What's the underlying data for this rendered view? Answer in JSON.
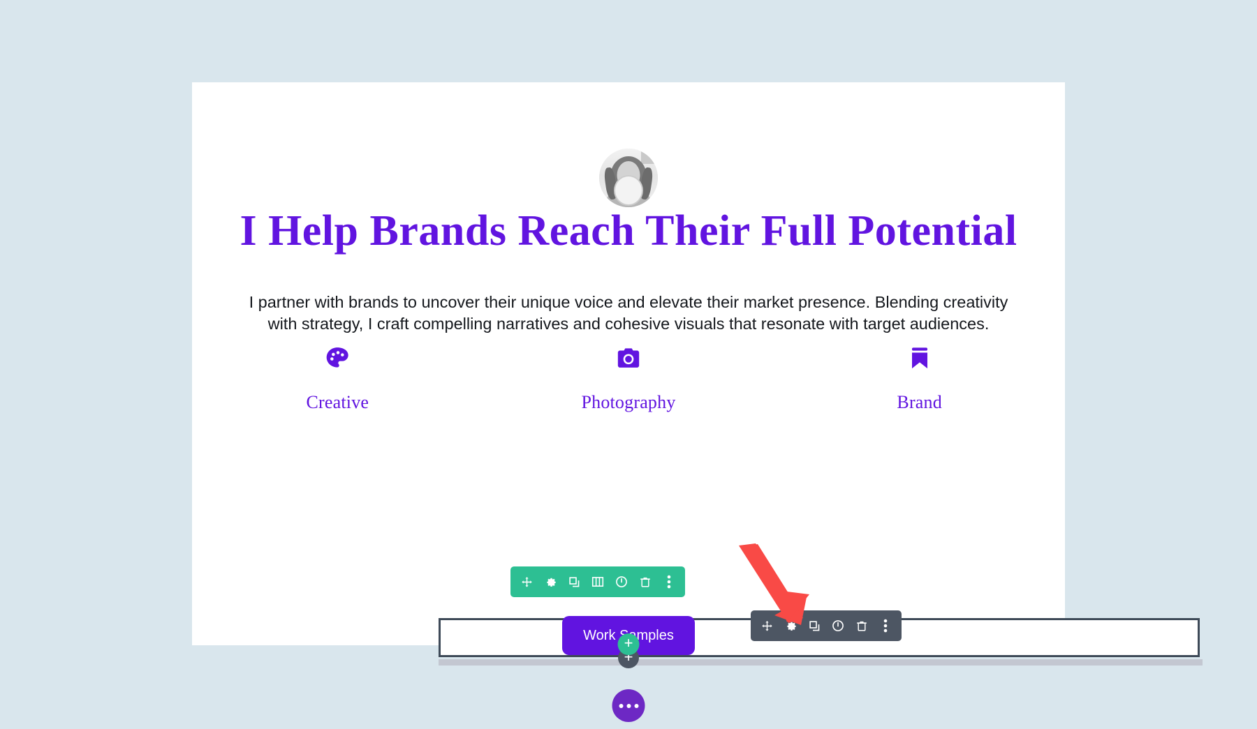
{
  "page": {
    "background_color": "#d9e6ed",
    "canvas_color": "#ffffff"
  },
  "hero": {
    "avatar_alt": "profile-photo",
    "headline": "I Help Brands Reach Their Full Potential",
    "headline_color": "#6114e0",
    "paragraph": "I partner with brands to uncover their unique voice and elevate their market presence. Blending creativity with strategy, I craft compelling narratives and cohesive visuals that resonate with target audiences."
  },
  "features": [
    {
      "icon": "palette-icon",
      "label": "Creative"
    },
    {
      "icon": "camera-icon",
      "label": "Photography"
    },
    {
      "icon": "bookmark-icon",
      "label": "Brand"
    }
  ],
  "cta": {
    "button_label": "Work Samples",
    "button_color": "#6114e0"
  },
  "builder": {
    "row_toolbar": {
      "color": "#2dbf93",
      "buttons": [
        {
          "icon": "move-icon",
          "tooltip": "Move"
        },
        {
          "icon": "gear-icon",
          "tooltip": "Settings"
        },
        {
          "icon": "duplicate-icon",
          "tooltip": "Duplicate"
        },
        {
          "icon": "columns-icon",
          "tooltip": "Column Structure"
        },
        {
          "icon": "power-icon",
          "tooltip": "Disable"
        },
        {
          "icon": "trash-icon",
          "tooltip": "Delete"
        },
        {
          "icon": "kebab-menu-icon",
          "tooltip": "More Options"
        }
      ]
    },
    "module_toolbar": {
      "color": "#4d5663",
      "buttons": [
        {
          "icon": "move-icon",
          "tooltip": "Move"
        },
        {
          "icon": "gear-icon",
          "tooltip": "Settings"
        },
        {
          "icon": "duplicate-icon",
          "tooltip": "Duplicate"
        },
        {
          "icon": "power-icon",
          "tooltip": "Disable"
        },
        {
          "icon": "trash-icon",
          "tooltip": "Delete"
        },
        {
          "icon": "kebab-menu-icon",
          "tooltip": "More Options"
        }
      ]
    },
    "add_module_label": "+",
    "add_section_label": "+",
    "menu_label": "",
    "annotation": {
      "type": "arrow",
      "color": "#f94a46",
      "points_to": "gear-icon"
    }
  }
}
